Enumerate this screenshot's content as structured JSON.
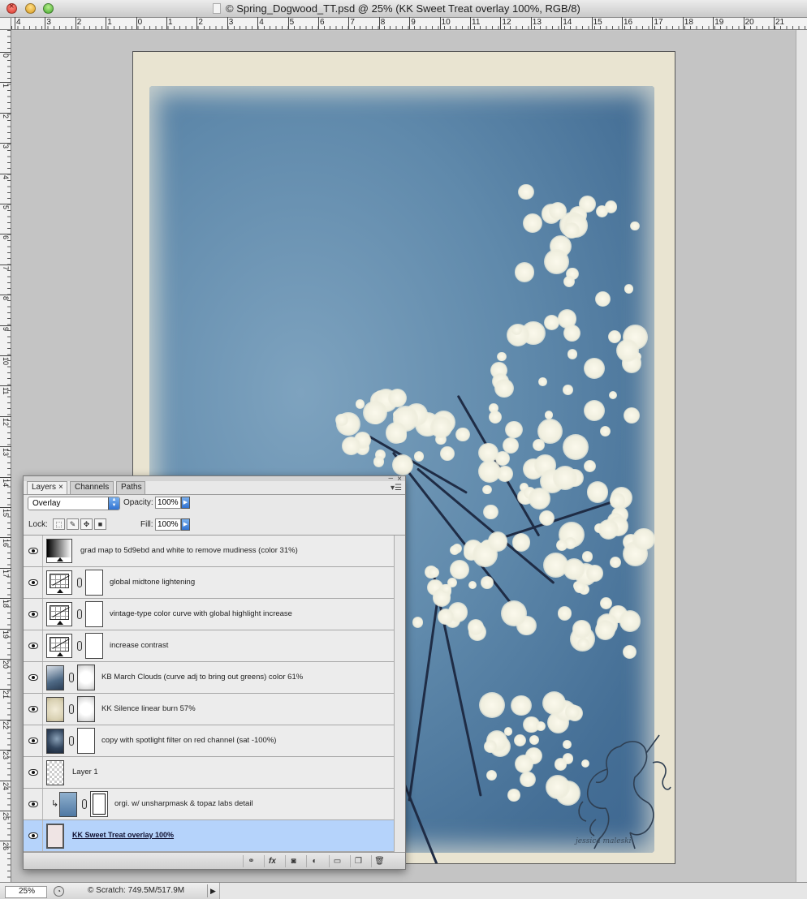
{
  "window": {
    "title": "© Spring_Dogwood_TT.psd @ 25% (KK Sweet Treat overlay 100%, RGB/8)"
  },
  "ruler": {
    "top_labels": [
      "4",
      "3",
      "2",
      "1",
      "0",
      "1",
      "2",
      "3",
      "4",
      "5",
      "6",
      "7",
      "8",
      "9",
      "10",
      "11",
      "12",
      "13",
      "14",
      "15",
      "16",
      "17",
      "18",
      "19",
      "20",
      "21"
    ],
    "left_labels": [
      "0",
      "1",
      "2",
      "3",
      "4",
      "5",
      "6",
      "7",
      "8",
      "9",
      "10",
      "11",
      "12",
      "13",
      "14",
      "15",
      "16",
      "17",
      "18",
      "19",
      "20",
      "21",
      "22",
      "23",
      "24",
      "25",
      "26"
    ]
  },
  "canvas": {
    "signature": "jessica maleski"
  },
  "status": {
    "zoom": "25%",
    "scratch": "© Scratch: 749.5M/517.9M"
  },
  "layers_panel": {
    "tabs": [
      "Layers",
      "Channels",
      "Paths"
    ],
    "blend_mode": "Overlay",
    "opacity_label": "Opacity:",
    "opacity_value": "100%",
    "lock_label": "Lock:",
    "fill_label": "Fill:",
    "fill_value": "100%",
    "layers": [
      {
        "name": "grad map to 5d9ebd and white to remove mudiness (color 31%)",
        "thumb": "gradmap",
        "mask": false,
        "visible": true,
        "selected": false
      },
      {
        "name": "global midtone lightening",
        "thumb": "curves",
        "mask": true,
        "visible": true,
        "selected": false
      },
      {
        "name": "vintage-type color curve with global highlight increase",
        "thumb": "curves",
        "mask": true,
        "visible": true,
        "selected": false
      },
      {
        "name": "increase contrast",
        "thumb": "curves",
        "mask": true,
        "visible": true,
        "selected": false
      },
      {
        "name": "KB March Clouds (curve adj to bring out greens) color 61%",
        "thumb": "clouds",
        "mask": true,
        "visible": true,
        "selected": false
      },
      {
        "name": "KK Silence linear burn 57%",
        "thumb": "silence",
        "mask": true,
        "visible": true,
        "selected": false
      },
      {
        "name": "copy with spotlight filter on red channel (sat -100%)",
        "thumb": "spotlight",
        "mask": true,
        "visible": true,
        "selected": false
      },
      {
        "name": "Layer 1",
        "thumb": "checker",
        "mask": false,
        "visible": true,
        "selected": false
      },
      {
        "name": "orgi. w/ unsharpmask & topaz labs detail",
        "thumb": "orig",
        "mask": true,
        "visible": true,
        "selected": false,
        "clipped": true
      },
      {
        "name": "KK Sweet Treat overlay 100%",
        "thumb": "sweet",
        "mask": false,
        "visible": true,
        "selected": true
      }
    ],
    "footer_icons": [
      "link-layers-icon",
      "fx-icon",
      "add-mask-icon",
      "adjustment-layer-icon",
      "new-group-icon",
      "new-layer-icon",
      "trash-icon"
    ]
  },
  "colors": {
    "selected_row": "#b5d3fb",
    "accent_blue": "#3173d2"
  }
}
